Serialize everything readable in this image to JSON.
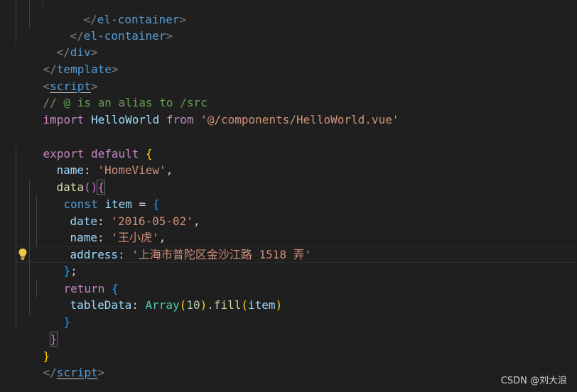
{
  "code": {
    "l1": {
      "a": "</",
      "b": "el-container",
      "c": ">"
    },
    "l2": {
      "a": "</",
      "b": "el-container",
      "c": ">"
    },
    "l3": {
      "a": "</",
      "b": "div",
      "c": ">"
    },
    "l4": {
      "a": "</",
      "b": "template",
      "c": ">"
    },
    "l5": {
      "a": "<",
      "b": "script",
      "c": ">"
    },
    "l6": {
      "comment": "// @ is an alias to /src"
    },
    "l7": {
      "kw": "import",
      "id": "HelloWorld",
      "from": "from",
      "str": "'@/components/HelloWorld.vue'"
    },
    "l9": {
      "kw1": "export",
      "kw2": "default",
      "brace": "{"
    },
    "l10": {
      "prop": "name",
      "colon": ": ",
      "str": "'HomeView'",
      "comma": ","
    },
    "l11": {
      "fn": "data",
      "paren": "()",
      "brace": "{"
    },
    "l12": {
      "decl": "const",
      "var": "item",
      "eq": " = ",
      "brace": "{"
    },
    "l13": {
      "prop": "date",
      "colon": ": ",
      "str": "'2016-05-02'",
      "comma": ","
    },
    "l14": {
      "prop": "name",
      "colon": ": ",
      "str": "'王小虎'",
      "comma": ","
    },
    "l15": {
      "prop": "address",
      "colon": ": ",
      "str": "'上海市普陀区金沙江路 1518 弄'"
    },
    "l16": {
      "brace": "}",
      "semi": ";"
    },
    "l17": {
      "kw": "return",
      "brace": "{"
    },
    "l18": {
      "prop": "tableData",
      "colon": ": ",
      "cls": "Array",
      "p1": "(",
      "num": "10",
      "p2": ")",
      "dot": ".",
      "fn": "fill",
      "p3": "(",
      "var": "item",
      "p4": ")"
    },
    "l19": {
      "brace": "}"
    },
    "l20": {
      "brace": "}"
    },
    "l21": {
      "brace": "}"
    },
    "l22": {
      "a": "</",
      "b": "script",
      "c": ">"
    }
  },
  "watermark": "CSDN @刘大浪",
  "colors": {
    "background": "#1f1f1f",
    "keyword": "#c586c0",
    "string": "#ce9178",
    "comment": "#6a9955",
    "tag": "#569cd6",
    "variable": "#9cdcfe"
  },
  "icons": {
    "gutter": "lightbulb-icon"
  }
}
